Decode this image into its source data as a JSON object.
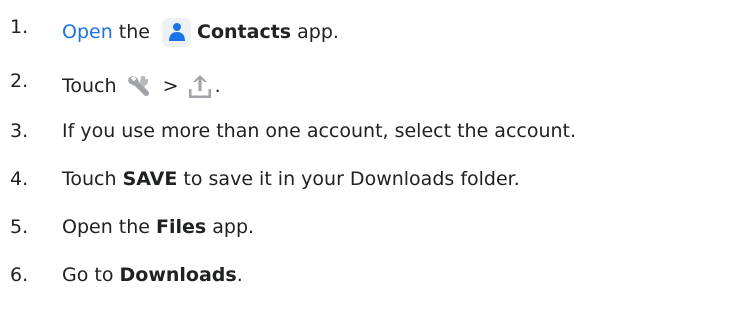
{
  "steps": [
    {
      "number": "1.",
      "link": "Open",
      "text_a": " the ",
      "bold": "Contacts",
      "text_b": " app.",
      "icons": [
        "contacts-app-icon"
      ]
    },
    {
      "number": "2.",
      "text_a": "Touch ",
      "separator": " > ",
      "text_b": ".",
      "icons": [
        "wrench-icon",
        "upload-icon"
      ]
    },
    {
      "number": "3.",
      "text": "If you use more than one account, select the account."
    },
    {
      "number": "4.",
      "text_a": "Touch ",
      "bold": "SAVE",
      "text_b": " to save it in your Downloads folder."
    },
    {
      "number": "5.",
      "text_a": "Open the ",
      "bold": "Files",
      "text_b": " app."
    },
    {
      "number": "6.",
      "text_a": "Go to ",
      "bold": "Downloads",
      "text_b": "."
    }
  ],
  "colors": {
    "text": "#202124",
    "link": "#1a73e8",
    "contacts_icon_bg": "#eef1f4",
    "contacts_icon_person": "#1a73e8",
    "toolbar_icon_gray": "#a0a4a8"
  }
}
